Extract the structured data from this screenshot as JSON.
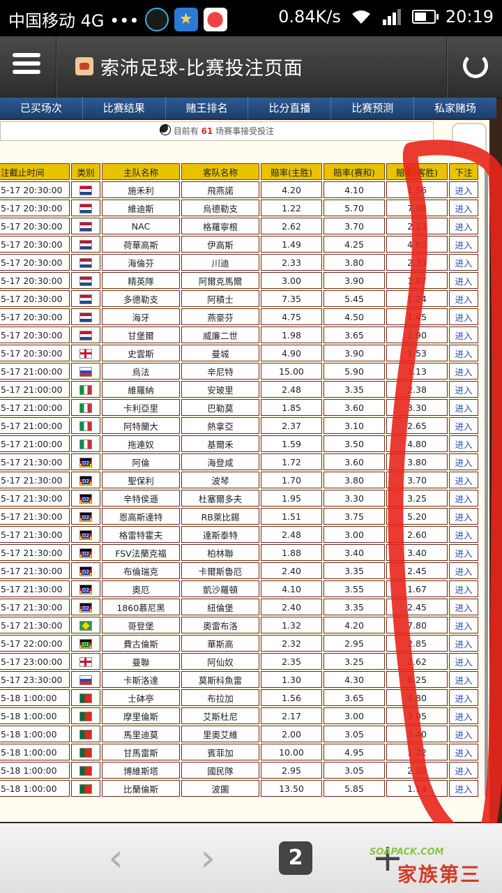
{
  "status_bar": {
    "carrier": "中国移动 4G •••",
    "speed": "0.84K/s",
    "time": "20:19",
    "app_icons": [
      "qq-icon",
      "star-icon",
      "map-pin-icon"
    ]
  },
  "header": {
    "title": "索沛足球-比赛投注页面",
    "menu_icon": "menu-icon",
    "refresh_icon": "refresh-icon"
  },
  "nav": {
    "items": [
      "已买场次",
      "比赛结果",
      "赌王排名",
      "比分直播",
      "比赛预测",
      "私家赌场"
    ]
  },
  "notice": {
    "prefix": "目前有",
    "count": "61",
    "suffix": "场赛事接受投注"
  },
  "table": {
    "headers": [
      "注截止时间",
      "类别",
      "主队名称",
      "客队名称",
      "赔率(主胜)",
      "赔率(赛和)",
      "赔率(客胜)",
      "下注"
    ],
    "bet_label": "进入",
    "rows": [
      {
        "time": "5-17 20:30:00",
        "flag": "nl",
        "home": "施禾利",
        "away": "飛燕諾",
        "o1": "4.20",
        "o2": "4.10",
        "o3": "1.56"
      },
      {
        "time": "5-17 20:30:00",
        "flag": "nl",
        "home": "維迪斯",
        "away": "烏德勒支",
        "o1": "1.22",
        "o2": "5.70",
        "o3": "7.80"
      },
      {
        "time": "5-17 20:30:00",
        "flag": "nl",
        "home": "NAC",
        "away": "格羅寧根",
        "o1": "2.62",
        "o2": "3.70",
        "o3": "2.13"
      },
      {
        "time": "5-17 20:30:00",
        "flag": "nl",
        "home": "荷華高斯",
        "away": "伊高斯",
        "o1": "1.49",
        "o2": "4.25",
        "o3": "4.65"
      },
      {
        "time": "5-17 20:30:00",
        "flag": "nl",
        "home": "海倫芬",
        "away": "川迪",
        "o1": "2.33",
        "o2": "3.80",
        "o3": "2.33"
      },
      {
        "time": "5-17 20:30:00",
        "flag": "nl",
        "home": "精英隊",
        "away": "阿爾克馬爾",
        "o1": "3.00",
        "o2": "3.90",
        "o3": "1.87"
      },
      {
        "time": "5-17 20:30:00",
        "flag": "nl",
        "home": "多德勒支",
        "away": "阿積士",
        "o1": "7.35",
        "o2": "5.45",
        "o3": "1.24"
      },
      {
        "time": "5-17 20:30:00",
        "flag": "nl",
        "home": "海牙",
        "away": "燕豪芬",
        "o1": "4.75",
        "o2": "4.50",
        "o3": "1.45"
      },
      {
        "time": "5-17 20:30:00",
        "flag": "nl",
        "home": "甘堡爾",
        "away": "威廉二世",
        "o1": "1.98",
        "o2": "3.65",
        "o3": "2.90"
      },
      {
        "time": "5-17 20:30:00",
        "flag": "en",
        "home": "史雲斯",
        "away": "曼城",
        "o1": "4.90",
        "o2": "3.90",
        "o3": "1.53"
      },
      {
        "time": "5-17 21:00:00",
        "flag": "ru",
        "home": "烏法",
        "away": "辛尼特",
        "o1": "15.00",
        "o2": "5.90",
        "o3": "1.13"
      },
      {
        "time": "5-17 21:00:00",
        "flag": "it",
        "home": "維羅納",
        "away": "安玻里",
        "o1": "2.48",
        "o2": "3.35",
        "o3": "2.38"
      },
      {
        "time": "5-17 21:00:00",
        "flag": "it",
        "home": "卡利亞里",
        "away": "巴勒莫",
        "o1": "1.85",
        "o2": "3.60",
        "o3": "3.30"
      },
      {
        "time": "5-17 21:00:00",
        "flag": "it",
        "home": "阿特蘭大",
        "away": "熱拿亞",
        "o1": "2.37",
        "o2": "3.10",
        "o3": "2.65"
      },
      {
        "time": "5-17 21:00:00",
        "flag": "it",
        "home": "拖連奴",
        "away": "基爾禾",
        "o1": "1.59",
        "o2": "3.50",
        "o3": "4.80"
      },
      {
        "time": "5-17 21:30:00",
        "flag": "d2",
        "home": "阿倫",
        "away": "海登咸",
        "o1": "1.72",
        "o2": "3.60",
        "o3": "3.80"
      },
      {
        "time": "5-17 21:30:00",
        "flag": "d2",
        "home": "聖保利",
        "away": "波琴",
        "o1": "1.70",
        "o2": "3.80",
        "o3": "3.70"
      },
      {
        "time": "5-17 21:30:00",
        "flag": "d2",
        "home": "辛特侯遜",
        "away": "杜塞爾多夫",
        "o1": "1.95",
        "o2": "3.30",
        "o3": "3.25"
      },
      {
        "time": "5-17 21:30:00",
        "flag": "d2",
        "home": "恩高斯達特",
        "away": "RB萊比錫",
        "o1": "1.51",
        "o2": "3.75",
        "o3": "5.20"
      },
      {
        "time": "5-17 21:30:00",
        "flag": "d2",
        "home": "格雷特霍夫",
        "away": "達斯泰特",
        "o1": "2.48",
        "o2": "3.00",
        "o3": "2.60"
      },
      {
        "time": "5-17 21:30:00",
        "flag": "d2",
        "home": "FSV法蘭克福",
        "away": "柏林聯",
        "o1": "1.88",
        "o2": "3.40",
        "o3": "3.40"
      },
      {
        "time": "5-17 21:30:00",
        "flag": "d2",
        "home": "布倫瑞克",
        "away": "卡爾斯魯厄",
        "o1": "2.40",
        "o2": "3.35",
        "o3": "2.45"
      },
      {
        "time": "5-17 21:30:00",
        "flag": "d2",
        "home": "奧厄",
        "away": "凱沙羅頓",
        "o1": "4.10",
        "o2": "3.55",
        "o3": "1.67"
      },
      {
        "time": "5-17 21:30:00",
        "flag": "d2",
        "home": "1860慕尼黑",
        "away": "紐倫堡",
        "o1": "2.40",
        "o2": "3.35",
        "o3": "2.45"
      },
      {
        "time": "5-17 21:30:00",
        "flag": "br",
        "home": "哥登堡",
        "away": "奧雷布洛",
        "o1": "1.32",
        "o2": "4.20",
        "o3": "7.80"
      },
      {
        "time": "5-17 22:00:00",
        "flag": "d1",
        "home": "費古倫斯",
        "away": "華斯高",
        "o1": "2.32",
        "o2": "2.95",
        "o3": "2.85"
      },
      {
        "time": "5-17 23:00:00",
        "flag": "en",
        "home": "曼聯",
        "away": "阿仙奴",
        "o1": "2.35",
        "o2": "3.25",
        "o3": "2.62"
      },
      {
        "time": "5-17 23:30:00",
        "flag": "ru",
        "home": "卡斯洛達",
        "away": "莫斯科魚雷",
        "o1": "1.30",
        "o2": "4.30",
        "o3": "8.25"
      },
      {
        "time": "5-18 1:00:00",
        "flag": "pt",
        "home": "士砵亭",
        "away": "布拉加",
        "o1": "1.56",
        "o2": "3.65",
        "o3": "4.80"
      },
      {
        "time": "5-18 1:00:00",
        "flag": "pt",
        "home": "摩里倫斯",
        "away": "艾斯杜尼",
        "o1": "2.17",
        "o2": "3.00",
        "o3": "3.05"
      },
      {
        "time": "5-18 1:00:00",
        "flag": "pt",
        "home": "馬里迪莫",
        "away": "里奧艾維",
        "o1": "2.00",
        "o2": "3.05",
        "o3": "3.40"
      },
      {
        "time": "5-18 1:00:00",
        "flag": "pt",
        "home": "甘馬雷斯",
        "away": "賓菲加",
        "o1": "10.00",
        "o2": "4.95",
        "o3": "1.22"
      },
      {
        "time": "5-18 1:00:00",
        "flag": "pt",
        "home": "博維斯塔",
        "away": "國民隊",
        "o1": "2.95",
        "o2": "3.05",
        "o3": "2.20"
      },
      {
        "time": "5-18 1:00:00",
        "flag": "pt",
        "home": "比蘭倫斯",
        "away": "波圖",
        "o1": "13.50",
        "o2": "5.85",
        "o3": "1.14"
      }
    ]
  },
  "toolbar": {
    "back_icon": "back-arrow-icon",
    "forward_icon": "forward-arrow-icon",
    "tab_count": "2",
    "add_icon": "add-tab-icon"
  },
  "watermark": {
    "top": "SOAPACK.COM",
    "bottom": "家族第三"
  }
}
